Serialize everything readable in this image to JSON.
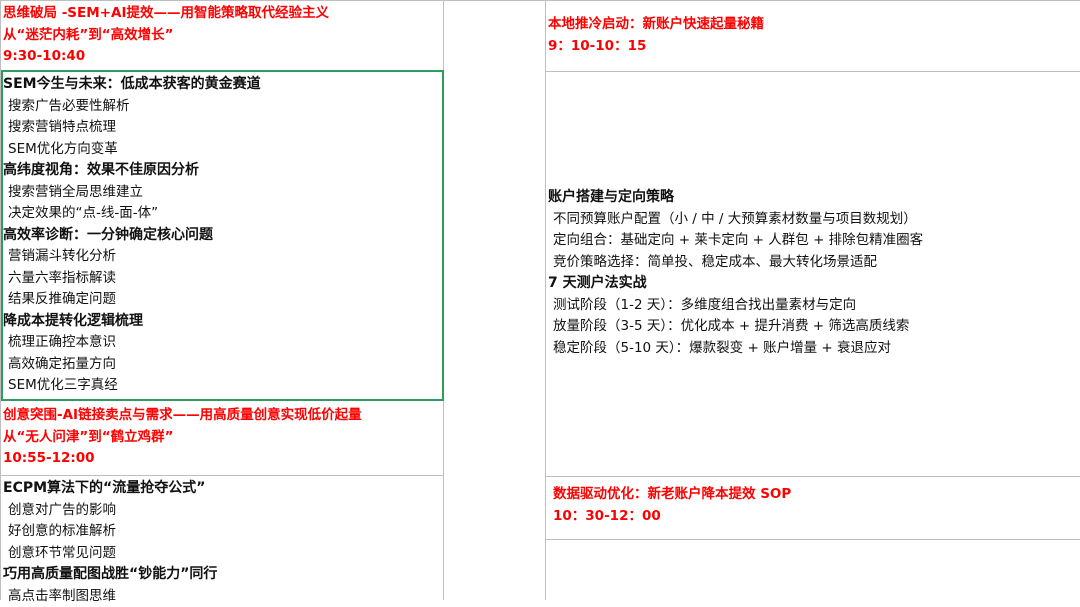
{
  "left_block1": {
    "title": "思维破局 -SEM+AI提效——用智能策略取代经验主义",
    "subtitle": "从“迷茫内耗”到“高效增长”",
    "time": "9:30-10:40"
  },
  "left_sem": {
    "sections": [
      {
        "heading": "SEM今生与未来：低成本获客的黄金赛道",
        "items": [
          "搜索广告必要性解析",
          "搜索营销特点梳理",
          "SEM优化方向变革"
        ]
      },
      {
        "heading": "高纬度视角：效果不佳原因分析",
        "items": [
          "搜索营销全局思维建立",
          "决定效果的“点-线-面-体”"
        ]
      },
      {
        "heading": "高效率诊断：一分钟确定核心问题",
        "items": [
          "营销漏斗转化分析",
          "六量六率指标解读",
          "结果反推确定问题"
        ]
      },
      {
        "heading": "降成本提转化逻辑梳理",
        "items": [
          "梳理正确控本意识",
          "高效确定拓量方向",
          "SEM优化三字真经"
        ]
      }
    ]
  },
  "left_block2": {
    "title": "创意突围-AI链接卖点与需求——用高质量创意实现低价起量",
    "subtitle": "从“无人问津”到“鹤立鸡群”",
    "time": "10:55-12:00"
  },
  "left_ecpm": {
    "sections": [
      {
        "heading": "ECPM算法下的“流量抢夺公式”",
        "items": [
          "创意对广告的影响",
          "好创意的标准解析",
          "创意环节常见问题"
        ]
      },
      {
        "heading": "巧用高质量配图战胜“钞能力”同行",
        "items": [
          "高点击率制图思维"
        ]
      }
    ]
  },
  "right_block1": {
    "title": "本地推冷启动：新账户快速起量秘籍",
    "time": "9：10-10：15"
  },
  "right_content": {
    "sections": [
      {
        "heading": "账户搭建与定向策略",
        "items": [
          "不同预算账户配置（小 / 中 / 大预算素材数量与项目数规划）",
          "定向组合：基础定向 + 莱卡定向 + 人群包 + 排除包精准圈客",
          "竞价策略选择：简单投、稳定成本、最大转化场景适配"
        ]
      },
      {
        "heading": "7 天测户法实战",
        "items": [
          "测试阶段（1-2 天）：多维度组合找出量素材与定向",
          "放量阶段（3-5 天）：优化成本 + 提升消费 + 筛选高质线索",
          "稳定阶段（5-10 天）：爆款裂变 + 账户增量 + 衰退应对"
        ]
      }
    ]
  },
  "right_block2": {
    "title": "数据驱动优化：新老账户降本提效 SOP",
    "time": "10：30-12：00"
  },
  "colors": {
    "red": "#ff0000",
    "green_border": "#2e9b5f",
    "grid": "#bfbfbf"
  }
}
